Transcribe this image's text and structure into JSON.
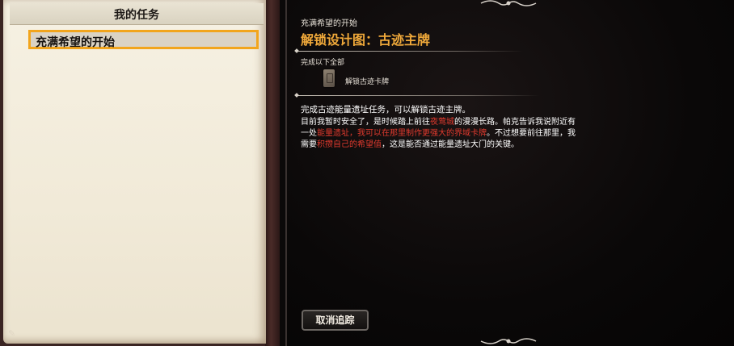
{
  "journal": {
    "title": "我的任务",
    "quests": [
      {
        "label": "充满希望的开始",
        "selected": true
      }
    ],
    "highlight_color": "#f2a51c"
  },
  "detail": {
    "quest_name": "充满希望的开始",
    "objective_title": "解锁设计图：古迹主牌",
    "requirement_heading": "完成以下全部",
    "requirements": [
      {
        "icon": "card-icon",
        "label": "解锁古迹卡牌"
      }
    ],
    "summary": "完成古迹能量遗址任务，可以解锁古迹主牌。",
    "description": {
      "p1": "目前我暂时安全了，是时候踏上前往",
      "p1_hl": "夜莺城",
      "p2": "的漫漫长路。帕克告诉我说附近有一处",
      "p2_hl": "能量遗址，我可以在那里制作更强大的界域卡牌",
      "p3": "。不过想要前往那里，我需要",
      "p3_hl": "积攒自己的希望值",
      "p4": "，这是能否通过能量遗址大门的关键。"
    },
    "untrack_button": "取消追踪",
    "accent_color": "#f0a93a",
    "highlight_text_color": "#e03a2e"
  }
}
